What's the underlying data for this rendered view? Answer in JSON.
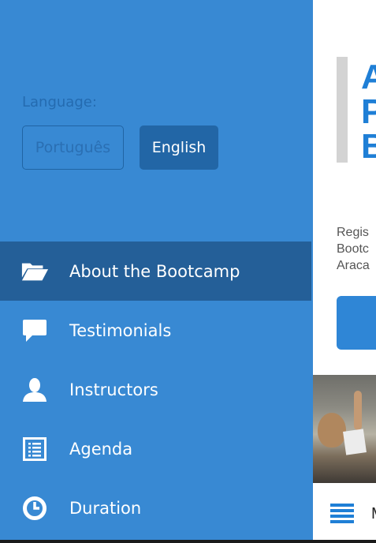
{
  "background_page": {
    "hero_title_visible": "A\nP\nB",
    "register_text_visible": "Regis\nBootc\nAraca",
    "menu_letter": "M"
  },
  "drawer": {
    "language_label": "Language:",
    "languages": [
      {
        "label": "Português",
        "selected": false
      },
      {
        "label": "English",
        "selected": true
      }
    ],
    "nav_items": [
      {
        "label": "About the Bootcamp",
        "icon": "folder-open-icon",
        "active": true
      },
      {
        "label": "Testimonials",
        "icon": "speech-bubble-icon",
        "active": false
      },
      {
        "label": "Instructors",
        "icon": "user-icon",
        "active": false
      },
      {
        "label": "Agenda",
        "icon": "list-document-icon",
        "active": false
      },
      {
        "label": "Duration",
        "icon": "clock-icon",
        "active": false
      }
    ]
  },
  "colors": {
    "drawer_bg": "#3889d3",
    "active_item_bg": "#245f98",
    "selected_lang_bg": "#2266a6",
    "accent_blue": "#1f7fd6"
  }
}
